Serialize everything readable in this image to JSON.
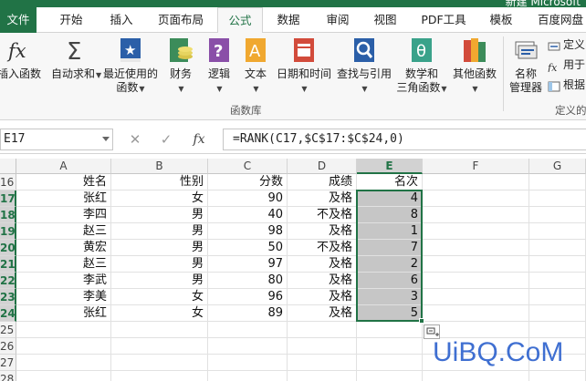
{
  "window": {
    "title": "新建 Microsoft"
  },
  "tabs": [
    {
      "label": "文件"
    },
    {
      "label": "开始"
    },
    {
      "label": "插入"
    },
    {
      "label": "页面布局"
    },
    {
      "label": "公式"
    },
    {
      "label": "数据"
    },
    {
      "label": "审阅"
    },
    {
      "label": "视图"
    },
    {
      "label": "PDF工具"
    },
    {
      "label": "模板"
    },
    {
      "label": "百度网盘"
    }
  ],
  "ribbon": {
    "insert_function": "插入函数",
    "autosum": "自动求和",
    "recent_1": "最近使用的",
    "recent_2": "函数",
    "financial": "财务",
    "logical": "逻辑",
    "text": "文本",
    "datetime": "日期和时间",
    "lookup": "查找与引用",
    "math_1": "数学和",
    "math_2": "三角函数",
    "more": "其他函数",
    "name_mgr_1": "名称",
    "name_mgr_2": "管理器",
    "define_name": "定义",
    "use_in_formula": "用于",
    "create_from_sel": "根据",
    "group_library": "函数库",
    "group_defined": "定义的"
  },
  "formula_bar": {
    "name_box": "E17",
    "cancel_glyph": "✕",
    "enter_glyph": "✓",
    "fx_glyph": "fx",
    "formula": "=RANK(C17,$C$17:$C$24,0)"
  },
  "grid": {
    "columns": [
      "A",
      "B",
      "C",
      "D",
      "E",
      "F",
      "G"
    ],
    "rows": [
      {
        "num": "16",
        "cells": [
          "姓名",
          "性别",
          "分数",
          "成绩",
          "名次"
        ]
      },
      {
        "num": "17",
        "cells": [
          "张红",
          "女",
          "90",
          "及格",
          "4"
        ]
      },
      {
        "num": "18",
        "cells": [
          "李四",
          "男",
          "40",
          "不及格",
          "8"
        ]
      },
      {
        "num": "19",
        "cells": [
          "赵三",
          "男",
          "98",
          "及格",
          "1"
        ]
      },
      {
        "num": "20",
        "cells": [
          "黄宏",
          "男",
          "50",
          "不及格",
          "7"
        ]
      },
      {
        "num": "21",
        "cells": [
          "赵三",
          "男",
          "97",
          "及格",
          "2"
        ]
      },
      {
        "num": "22",
        "cells": [
          "李武",
          "男",
          "80",
          "及格",
          "6"
        ]
      },
      {
        "num": "23",
        "cells": [
          "李美",
          "女",
          "96",
          "及格",
          "3"
        ]
      },
      {
        "num": "24",
        "cells": [
          "张红",
          "女",
          "89",
          "及格",
          "5"
        ]
      },
      {
        "num": "25",
        "cells": [
          "",
          "",
          "",
          "",
          ""
        ]
      },
      {
        "num": "26",
        "cells": [
          "",
          "",
          "",
          "",
          ""
        ]
      },
      {
        "num": "27",
        "cells": [
          "",
          "",
          "",
          "",
          ""
        ]
      },
      {
        "num": "28",
        "cells": [
          "",
          "",
          "",
          "",
          ""
        ]
      }
    ]
  },
  "watermark": "UiBQ.CoM",
  "colors": {
    "accent": "#217346",
    "selection": "#c6c6c6"
  }
}
